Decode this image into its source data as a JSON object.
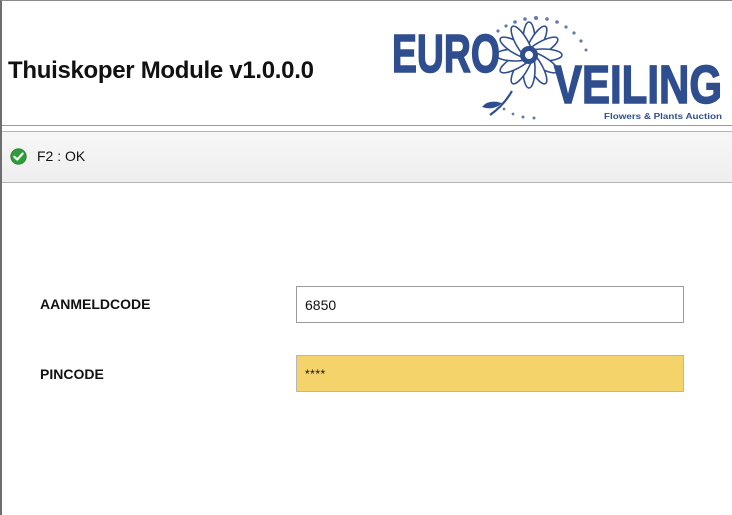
{
  "header": {
    "title": "Thuiskoper Module v1.0.0.0",
    "logo": {
      "word_left": "EURO",
      "word_right": "VEILING",
      "tagline": "Flowers & Plants Auction",
      "brand_color": "#2f4e8f"
    }
  },
  "toolbar": {
    "ok_label": "F2 : OK",
    "ok_icon": "check-circle-icon",
    "ok_icon_color": "#2e9d3a"
  },
  "form": {
    "login_label": "AANMELDCODE",
    "login_value": "6850",
    "pin_label": "PINCODE",
    "pin_value": "****",
    "pin_focus_color": "#f3d36a"
  }
}
